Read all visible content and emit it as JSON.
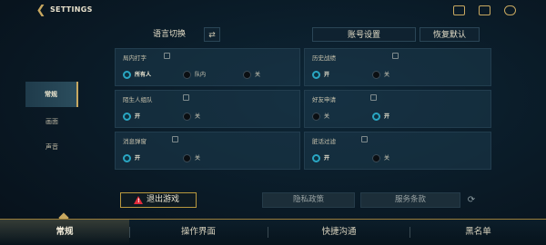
{
  "header": {
    "title": "SETTINGS",
    "icons": [
      "back-arrow-icon",
      "mission-icon",
      "chat-icon",
      "friends-icon"
    ]
  },
  "sidebar": {
    "items": [
      {
        "label": "常规",
        "active": true
      },
      {
        "label": "画面",
        "active": false
      },
      {
        "label": "声音",
        "active": false
      }
    ]
  },
  "toprow": {
    "language_label": "语言切换",
    "account_label": "账号设置",
    "reset_label": "恢复默认"
  },
  "panels": [
    {
      "title": "局内打字",
      "options": [
        {
          "label": "所有人",
          "selected": true
        },
        {
          "label": "队内",
          "selected": false
        },
        {
          "label": "关",
          "selected": false
        }
      ]
    },
    {
      "title": "历史战绩",
      "options": [
        {
          "label": "开",
          "selected": true
        },
        {
          "label": "关",
          "selected": false
        }
      ]
    },
    {
      "title": "陌生人组队",
      "options": [
        {
          "label": "开",
          "selected": true
        },
        {
          "label": "关",
          "selected": false
        }
      ]
    },
    {
      "title": "好友申请",
      "options": [
        {
          "label": "关",
          "selected": false
        },
        {
          "label": "开",
          "selected": true
        }
      ]
    },
    {
      "title": "消息弹窗",
      "options": [
        {
          "label": "开",
          "selected": true
        },
        {
          "label": "关",
          "selected": false
        }
      ]
    },
    {
      "title": "脏话过滤",
      "options": [
        {
          "label": "开",
          "selected": true
        },
        {
          "label": "关",
          "selected": false
        }
      ]
    }
  ],
  "footer": {
    "quit_label": "退出游戏",
    "privacy_label": "隐私政策",
    "terms_label": "服务条款"
  },
  "bottomnav": {
    "tabs": [
      {
        "label": "常规",
        "active": true
      },
      {
        "label": "操作界面",
        "active": false
      },
      {
        "label": "快捷沟通",
        "active": false
      },
      {
        "label": "黑名单",
        "active": false
      }
    ]
  },
  "colors": {
    "accent": "#c8a860",
    "radio_on": "#2aa6c2",
    "warning": "#e12b3a"
  }
}
